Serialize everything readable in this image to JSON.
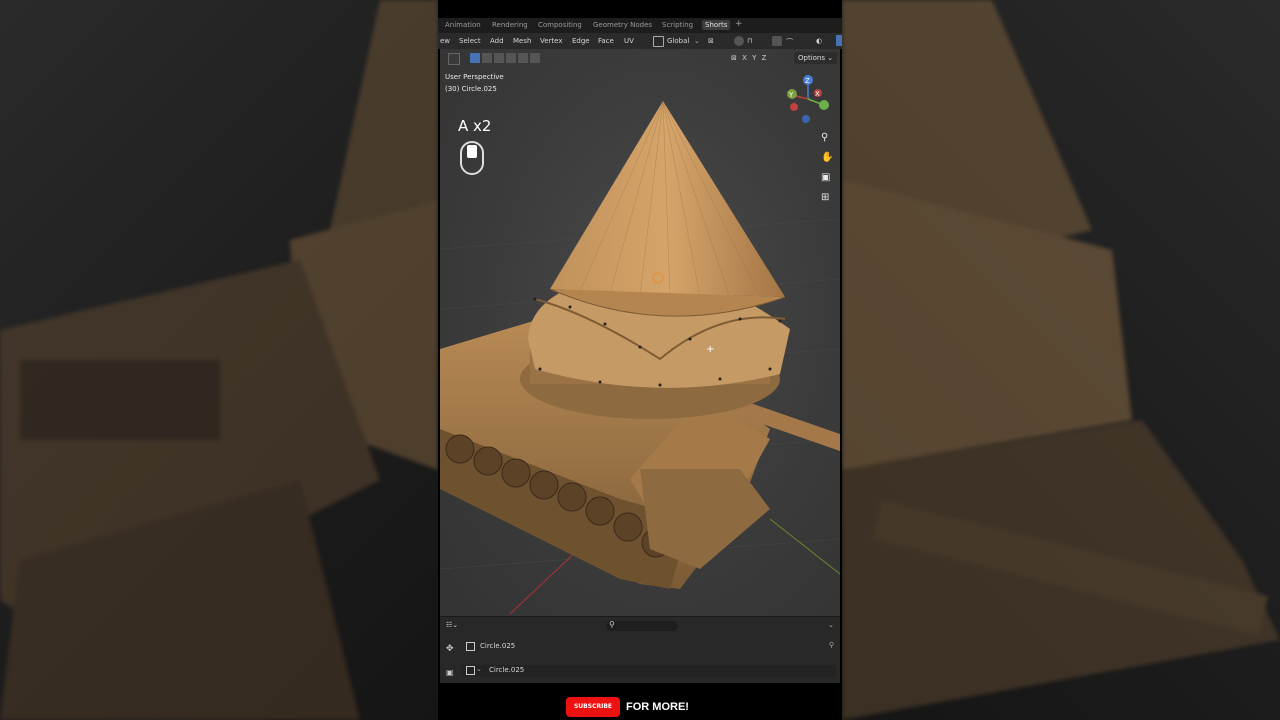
{
  "workspace_tabs": [
    "Animation",
    "Rendering",
    "Compositing",
    "Geometry Nodes",
    "Scripting",
    "Shorts"
  ],
  "active_tab": "Shorts",
  "add_tab": "+",
  "menus": [
    "ew",
    "Select",
    "Add",
    "Mesh",
    "Vertex",
    "Edge",
    "Face",
    "UV"
  ],
  "transform_orientation": "Global",
  "axis_toggles": [
    "X",
    "Y",
    "Z"
  ],
  "options_label": "Options",
  "viewport": {
    "view_name": "User Perspective",
    "object_info": "(30) Circle.025",
    "shortcut_hint": "A x2"
  },
  "gizmo_axes": [
    "Z",
    "Y",
    "X"
  ],
  "properties": {
    "object_name": "Circle.025",
    "mesh_name": "Circle.025"
  },
  "cta": {
    "subscribe": "SUBSCRIBE",
    "for_more": "FOR MORE!"
  },
  "colors": {
    "model": "#b98a52",
    "accent": "#e11010",
    "ui_dark": "#2a2a2a"
  }
}
